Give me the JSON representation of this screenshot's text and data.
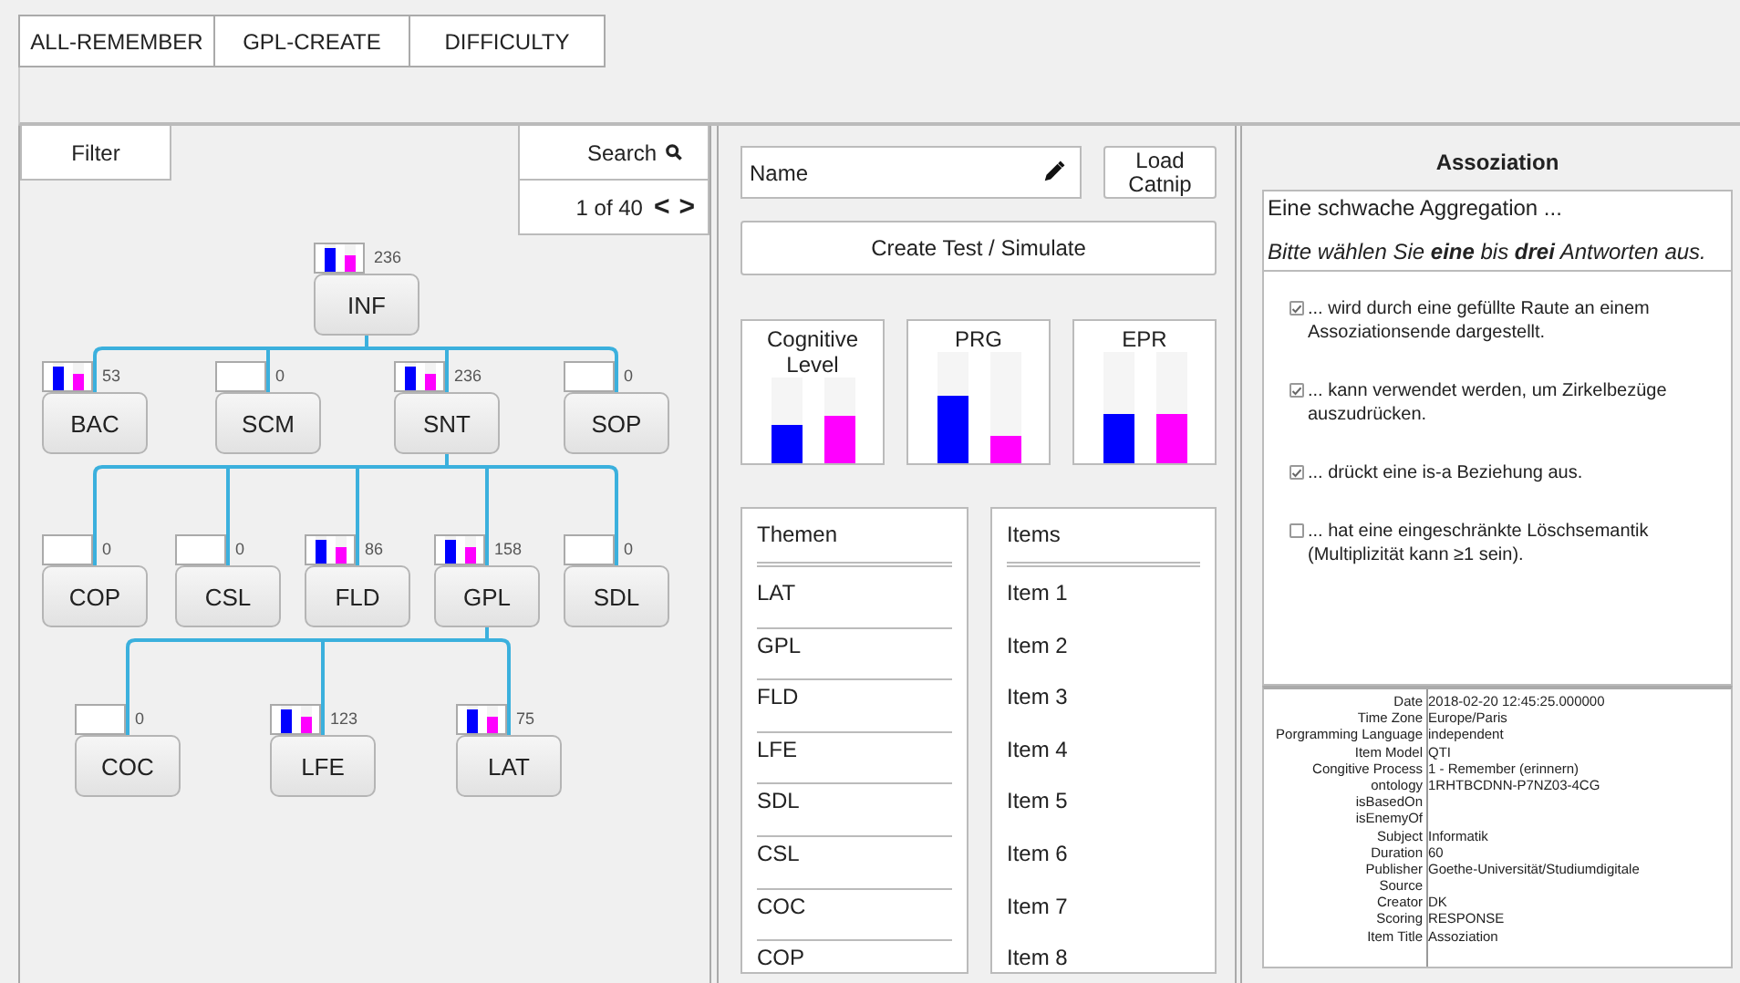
{
  "tabs": [
    {
      "label": "ALL-REMEMBER",
      "selected": false
    },
    {
      "label": "GPL-CREATE",
      "selected": false
    },
    {
      "label": "DIFFICULTY",
      "selected": false
    }
  ],
  "left": {
    "filter": "Filter",
    "search": "Search",
    "pager": "1 of 40",
    "prev": "<",
    "next": ">",
    "tree": {
      "label": "INF",
      "count": "236",
      "bars": [
        {
          "level": 0.85,
          "color": "#0000ff"
        },
        {
          "level": 0.6,
          "color": "#ff00ff"
        }
      ],
      "children": [
        {
          "label": "BAC",
          "count": "53",
          "bars": [
            {
              "level": 0.85,
              "color": "#0000ff"
            },
            {
              "level": 0.6,
              "color": "#ff00ff"
            }
          ]
        },
        {
          "label": "SCM",
          "count": "0"
        },
        {
          "label": "SNT",
          "count": "236",
          "bars": [
            {
              "level": 0.85,
              "color": "#0000ff"
            },
            {
              "level": 0.6,
              "color": "#ff00ff"
            }
          ],
          "children": [
            {
              "label": "COP",
              "count": "0"
            },
            {
              "label": "CSL",
              "count": "0"
            },
            {
              "label": "FLD",
              "count": "86",
              "bars": [
                {
                  "level": 0.85,
                  "color": "#0000ff"
                },
                {
                  "level": 0.6,
                  "color": "#ff00ff"
                }
              ]
            },
            {
              "label": "GPL",
              "count": "158",
              "bars": [
                {
                  "level": 0.85,
                  "color": "#0000ff"
                },
                {
                  "level": 0.6,
                  "color": "#ff00ff"
                }
              ],
              "children": [
                {
                  "label": "COC",
                  "count": "0"
                },
                {
                  "label": "LFE",
                  "count": "123",
                  "bars": [
                    {
                      "level": 0.85,
                      "color": "#0000ff"
                    },
                    {
                      "level": 0.6,
                      "color": "#ff00ff"
                    }
                  ]
                },
                {
                  "label": "LAT",
                  "count": "75",
                  "bars": [
                    {
                      "level": 0.85,
                      "color": "#0000ff"
                    },
                    {
                      "level": 0.6,
                      "color": "#ff00ff"
                    }
                  ]
                }
              ]
            },
            {
              "label": "SDL",
              "count": "0"
            }
          ]
        },
        {
          "label": "SOP",
          "count": "0"
        }
      ]
    }
  },
  "middle": {
    "name_placeholder": "Name",
    "load": "Load Catnip",
    "create": "Create Test / Simulate",
    "charts": [
      {
        "title": "Cognitive Level",
        "bars": [
          {
            "level": 0.45,
            "color": "#0000ff"
          },
          {
            "level": 0.55,
            "color": "#ff00ff"
          }
        ]
      },
      {
        "title": "PRG",
        "bars": [
          {
            "level": 0.6,
            "color": "#0000ff"
          },
          {
            "level": 0.25,
            "color": "#ff00ff"
          }
        ]
      },
      {
        "title": "EPR",
        "bars": [
          {
            "level": 0.45,
            "color": "#0000ff"
          },
          {
            "level": 0.45,
            "color": "#ff00ff"
          }
        ]
      }
    ],
    "themen": {
      "title": "Themen",
      "items": [
        "LAT",
        "GPL",
        "FLD",
        "LFE",
        "SDL",
        "CSL",
        "COC",
        "COP"
      ]
    },
    "items": {
      "title": "Items",
      "items": [
        "Item 1",
        "Item 2",
        "Item 3",
        "Item 4",
        "Item 5",
        "Item 6",
        "Item 7",
        "Item 8"
      ]
    }
  },
  "right": {
    "title": "Assoziation",
    "question": "Eine schwache Aggregation ...",
    "instruction": "Bitte wählen Sie **eine** bis **drei** Antworten aus.",
    "answers": [
      {
        "text": "... wird durch eine gefüllte Raute an einem Assoziationsende dargestellt.",
        "checked": true
      },
      {
        "text": "... kann verwendet werden, um Zirkelbezüge auszudrücken.",
        "checked": true
      },
      {
        "text": "... drückt eine is-a Beziehung aus.",
        "checked": true
      },
      {
        "text": "... hat eine eingeschränkte Löschsemantik (Multiplizität kann ≥1 sein).",
        "checked": false
      }
    ],
    "metadata": [
      {
        "key": "Date",
        "value": "2018-02-20 12:45:25.000000"
      },
      {
        "key": "Time Zone",
        "value": "Europe/Paris"
      },
      {
        "key": "Porgramming Language",
        "value": "independent"
      },
      {
        "key": "Item Model",
        "value": "QTI"
      },
      {
        "key": "Congitive Process",
        "value": " 1 - Remember (erinnern)"
      },
      {
        "key": "ontology",
        "value": " 1RHTBCDNN-P7NZ03-4CG"
      },
      {
        "key": "isBasedOn"
      },
      {
        "key": "isEnemyOf"
      },
      {
        "key": "Subject",
        "value": "Informatik"
      },
      {
        "key": "Duration",
        "value": "60"
      },
      {
        "key": "Publisher",
        "value": "Goethe-Universität/Studiumdigitale"
      },
      {
        "key": "Source"
      },
      {
        "key": "Creator",
        "value": "DK"
      },
      {
        "key": "Scoring",
        "value": "RESPONSE"
      },
      {
        "key": "Item Title",
        "value": "Assoziation"
      }
    ]
  }
}
